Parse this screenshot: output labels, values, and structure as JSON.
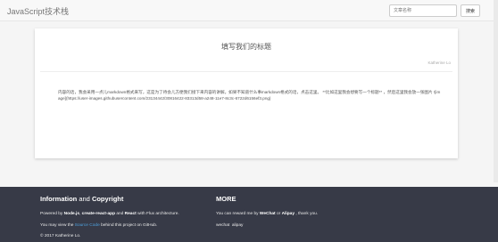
{
  "navbar": {
    "brand": "JavaScript技术栈",
    "search_placeholder": "文章名称",
    "search_button": "搜索"
  },
  "article": {
    "title": "填写我们的标题",
    "author": "Katherine Lo",
    "body": "内容的话，我会采用一点儿markdown格式来写，这是为了待会儿方便我们接下来内容的讲解。如果不知道什么事markdown格式的话，点击这里。 **比如这里我会想要写一个标题** ，然后这里我会放一张图片 ![image](https://user-images.githubusercontent.com/23134442/30816422-83313d58-a248-11e7-8c3c-6722d6156ef3.png)"
  },
  "footer": {
    "left": {
      "title_part1": "Information",
      "title_and": " and ",
      "title_part2": "Copyright",
      "line1_prefix": "Powered by ",
      "line1_b1": "Node.js",
      "line1_sep1": ", ",
      "line1_b2": "create-react-app",
      "line1_and": " and ",
      "line1_b3": "React",
      "line1_suffix": " with Flux architecture.",
      "line2_prefix": "You may view the ",
      "line2_link": "Source Code",
      "line2_suffix": " behind this project on GitHub.",
      "line3": "© 2017 Katherine Lo."
    },
    "right": {
      "title": "MORE",
      "line1_prefix": "You can reward me by ",
      "line1_b1": "WeChat",
      "line1_or": " or ",
      "line1_b2": "Alipay",
      "line1_suffix": " , thank you.",
      "reward_wechat": "wechat",
      "reward_alipay": "alipay"
    }
  }
}
